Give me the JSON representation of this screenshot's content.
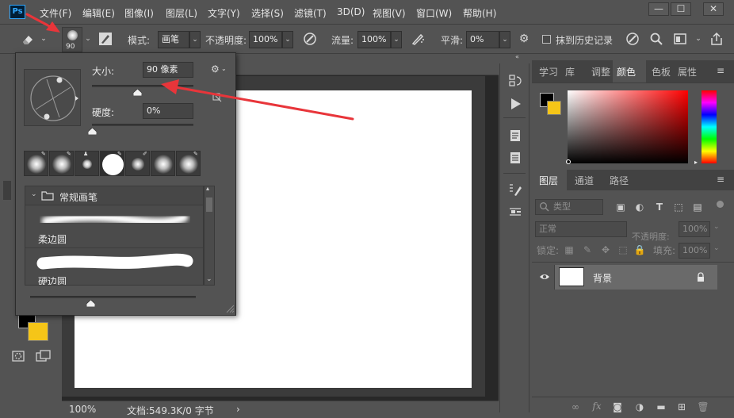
{
  "menubar": {
    "items": [
      "文件(F)",
      "编辑(E)",
      "图像(I)",
      "图层(L)",
      "文字(Y)",
      "选择(S)",
      "滤镜(T)",
      "3D(D)",
      "视图(V)",
      "窗口(W)",
      "帮助(H)"
    ],
    "logo": "Ps",
    "window_buttons": [
      "—",
      "☐",
      "✕"
    ]
  },
  "options": {
    "brush_size_label": "90",
    "mode_label": "模式:",
    "mode_value": "画笔",
    "opacity_label": "不透明度:",
    "opacity_value": "100%",
    "flow_label": "流量:",
    "flow_value": "100%",
    "smoothing_label": "平滑:",
    "smoothing_value": "0%",
    "erase_history_label": "抹到历史记录"
  },
  "brush_popup": {
    "size_label": "大小:",
    "size_value": "90 像素",
    "hardness_label": "硬度:",
    "hardness_value": "0%",
    "size_fraction": 0.45,
    "hardness_fraction": 0.0,
    "group_label": "常规画笔",
    "brushes": [
      "柔边圆",
      "硬边圆"
    ]
  },
  "status": {
    "zoom": "100%",
    "doc_info": "文档:549.3K/0 字节",
    "arrow": "›"
  },
  "panels": {
    "top_tabs": [
      "学习",
      "库",
      "调整",
      "颜色",
      "色板",
      "属性"
    ],
    "active_top_tab": "颜色",
    "layer_tabs": [
      "图层",
      "通道",
      "路径"
    ],
    "active_layer_tab": "图层",
    "filter_kind": "类型",
    "blend_mode": "正常",
    "opacity_label": "不透明度:",
    "opacity_value": "100%",
    "lock_label": "锁定:",
    "fill_label": "填充:",
    "fill_value": "100%",
    "layer_name": "背景"
  },
  "colors": {
    "foreground": "#000000",
    "background": "#f5c518",
    "arrow_red": "#e8353a",
    "ps_blue": "#31a8ff"
  }
}
